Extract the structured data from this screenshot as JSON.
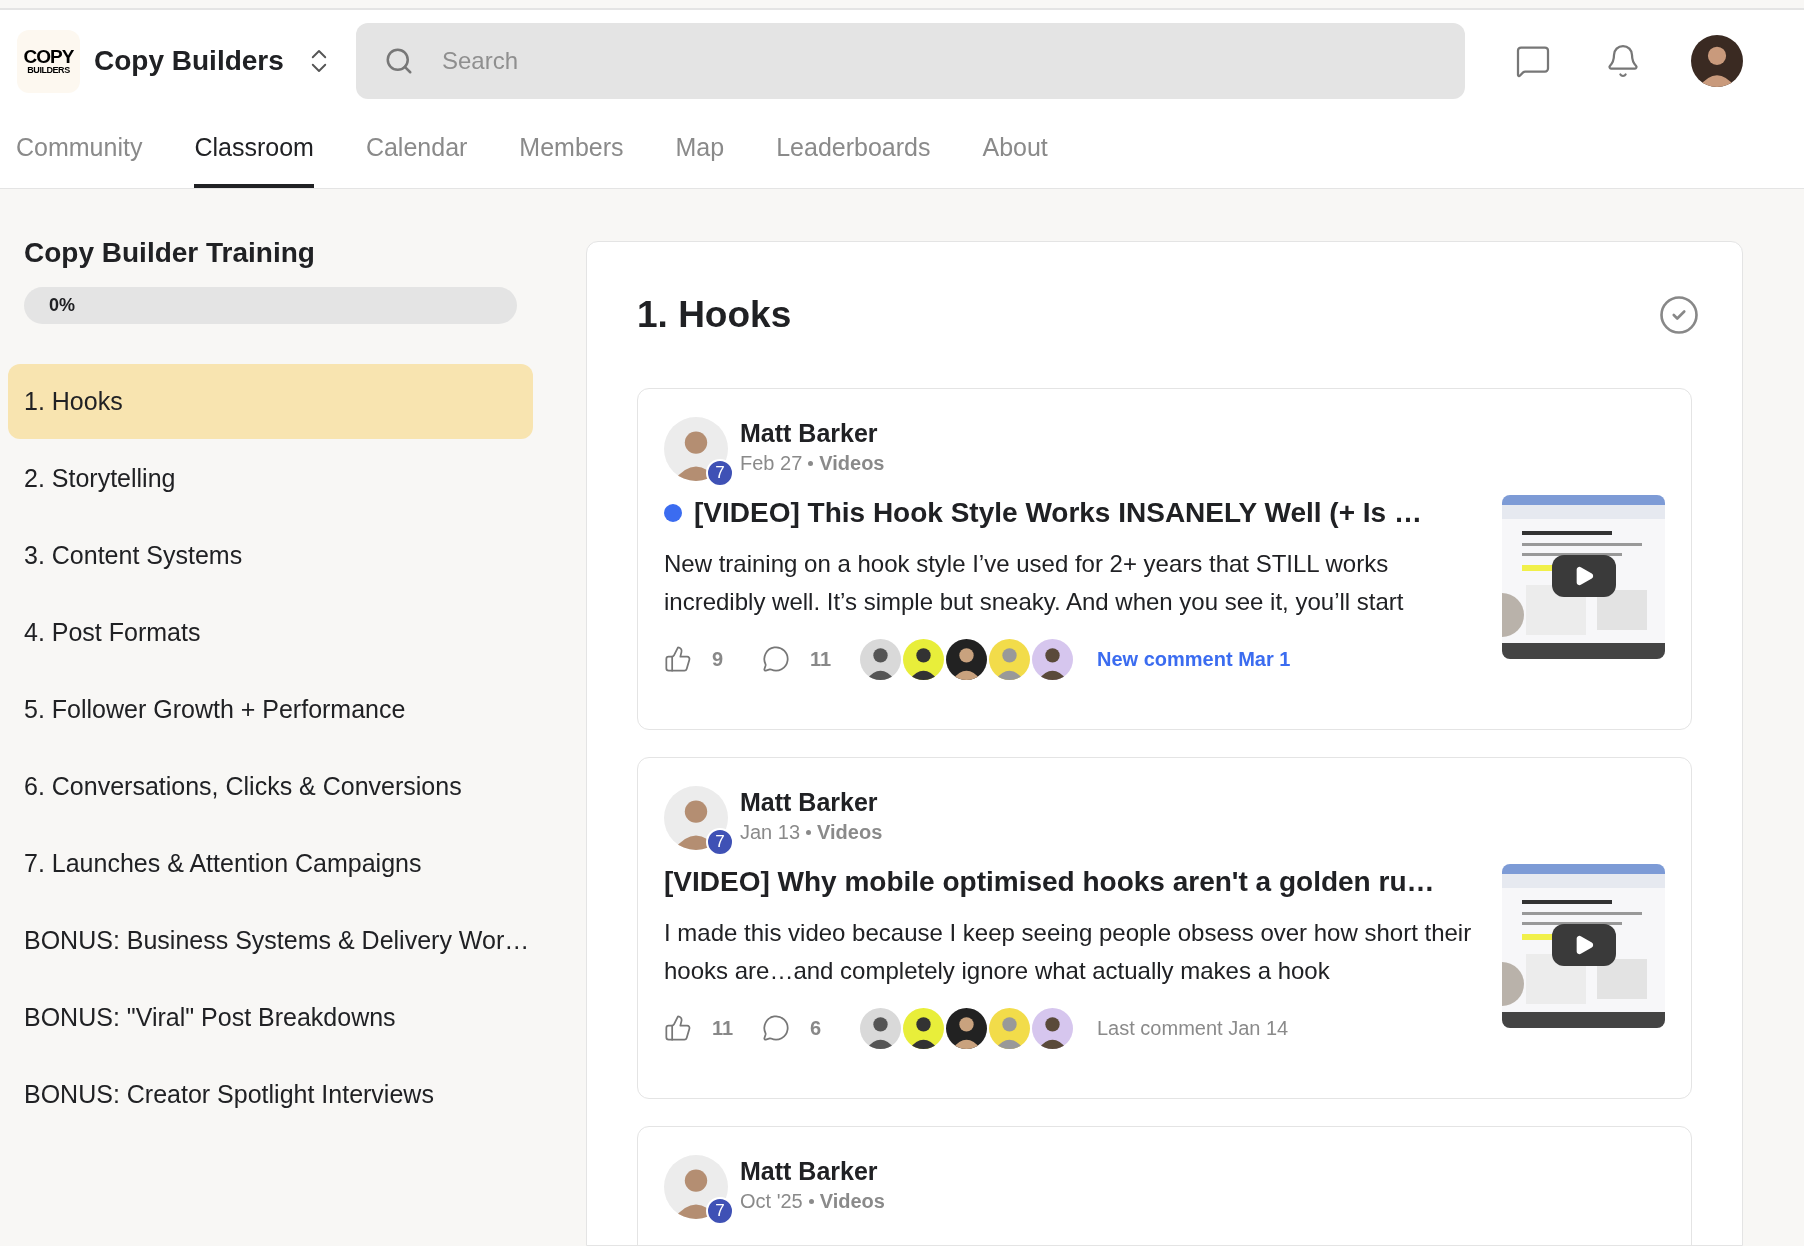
{
  "header": {
    "logo_lines": [
      "COPY",
      "BUILDERS"
    ],
    "group_name": "Copy Builders",
    "search": {
      "placeholder": "Search"
    }
  },
  "tabs": [
    {
      "label": "Community",
      "selected": false
    },
    {
      "label": "Classroom",
      "selected": true
    },
    {
      "label": "Calendar",
      "selected": false
    },
    {
      "label": "Members",
      "selected": false
    },
    {
      "label": "Map",
      "selected": false
    },
    {
      "label": "Leaderboards",
      "selected": false
    },
    {
      "label": "About",
      "selected": false
    }
  ],
  "sidebar": {
    "title": "Copy Builder Training",
    "progress": {
      "level": 0,
      "reading": "0%"
    },
    "items": [
      {
        "label": "1. Hooks",
        "selected": true
      },
      {
        "label": "2. Storytelling",
        "selected": false
      },
      {
        "label": "3. Content Systems",
        "selected": false
      },
      {
        "label": "4. Post Formats",
        "selected": false
      },
      {
        "label": "5. Follower Growth + Performance",
        "selected": false
      },
      {
        "label": "6. Conversations, Clicks & Conversions",
        "selected": false
      },
      {
        "label": "7. Launches & Attention Campaigns",
        "selected": false
      },
      {
        "label": "BONUS: Business Systems & Delivery Wor…",
        "selected": false
      },
      {
        "label": "BONUS: \"Viral\" Post Breakdowns",
        "selected": false
      },
      {
        "label": "BONUS: Creator Spotlight Interviews",
        "selected": false
      }
    ]
  },
  "lesson": {
    "title": "1. Hooks",
    "completed": false,
    "posts": [
      {
        "author": "Matt Barker",
        "level_badge": "7",
        "date": "Feb 27",
        "category": "Videos",
        "unread": true,
        "title": "[VIDEO] This Hook Style Works INSANELY Well (+ Is …",
        "body": "New training on a hook style I’ve used for 2+ years that STILL works incredibly well. It’s simple but sneaky. And when you see it, you’ll start",
        "likes": "9",
        "comments": "11",
        "activity": {
          "text": "New comment Mar 1",
          "new": true
        }
      },
      {
        "author": "Matt Barker",
        "level_badge": "7",
        "date": "Jan 13",
        "category": "Videos",
        "unread": false,
        "title": "[VIDEO] Why mobile optimised hooks aren't a golden ru…",
        "body": "I made this video because I keep seeing people obsess over how short their hooks are…and completely ignore what actually makes a hook",
        "likes": "11",
        "comments": "6",
        "activity": {
          "text": "Last comment Jan 14",
          "new": false
        }
      },
      {
        "author": "Matt Barker",
        "level_badge": "7",
        "date": "Oct '25",
        "category": "Videos"
      }
    ]
  }
}
